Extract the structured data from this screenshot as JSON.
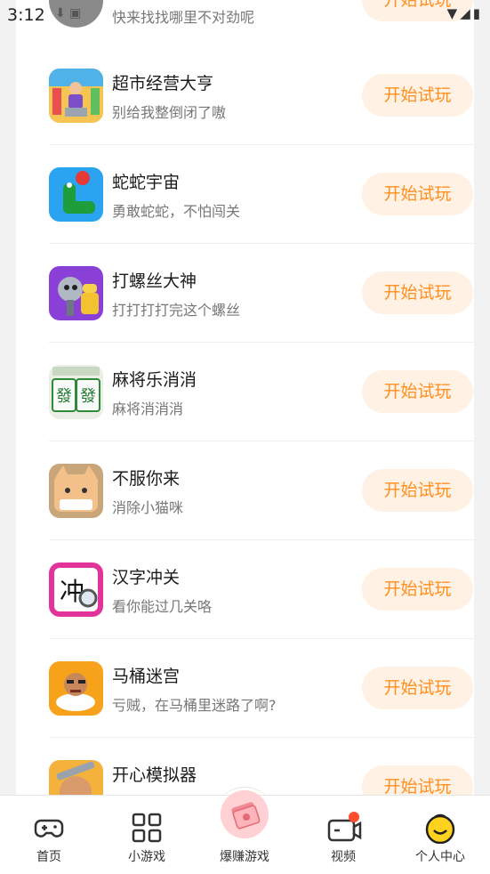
{
  "status_bar": {
    "time": "3:12"
  },
  "top_partial": {
    "subtitle": "快来找找哪里不对劲呢",
    "button": "开始试玩"
  },
  "games": [
    {
      "title": "超市经营大亨",
      "subtitle": "别给我整倒闭了嗷",
      "button": "开始试玩",
      "icon": "supermarket-icon"
    },
    {
      "title": "蛇蛇宇宙",
      "subtitle": "勇敢蛇蛇，不怕闯关",
      "button": "开始试玩",
      "icon": "snake-icon"
    },
    {
      "title": "打螺丝大神",
      "subtitle": "打打打打完这个螺丝",
      "button": "开始试玩",
      "icon": "screw-icon"
    },
    {
      "title": "麻将乐消消",
      "subtitle": "麻将消消消",
      "button": "开始试玩",
      "icon": "mahjong-icon"
    },
    {
      "title": "不服你来",
      "subtitle": "消除小猫咪",
      "button": "开始试玩",
      "icon": "cat-icon"
    },
    {
      "title": "汉字冲关",
      "subtitle": "看你能过几关咯",
      "button": "开始试玩",
      "icon": "hanzi-icon"
    },
    {
      "title": "马桶迷宫",
      "subtitle": "亏贼，在马桶里迷路了啊?",
      "button": "开始试玩",
      "icon": "toilet-icon"
    },
    {
      "title": "开心模拟器",
      "subtitle": "",
      "button": "开始试玩",
      "icon": "happy-sim-icon"
    }
  ],
  "tabs": [
    {
      "label": "首页",
      "icon": "gamepad-icon"
    },
    {
      "label": "小游戏",
      "icon": "grid-icon"
    },
    {
      "label": "爆赚游戏",
      "icon": "money-icon"
    },
    {
      "label": "视频",
      "icon": "video-icon"
    },
    {
      "label": "个人中心",
      "icon": "smiley-icon"
    }
  ],
  "colors": {
    "accent": "#ff8f1f",
    "button_bg": "#fff1e3",
    "badge": "#ff4d2e"
  }
}
